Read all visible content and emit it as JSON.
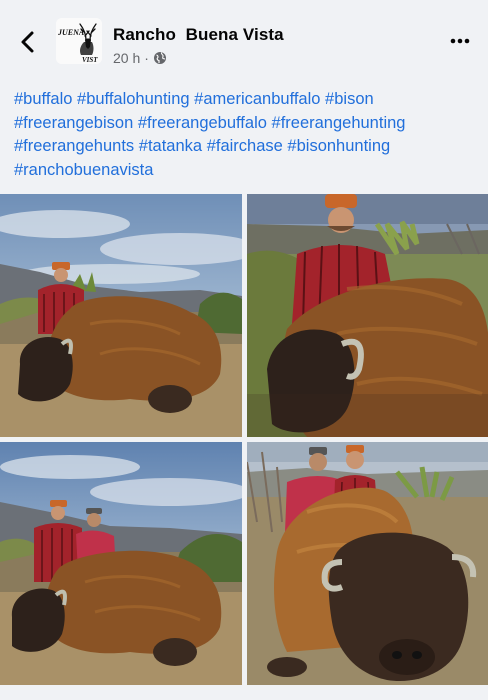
{
  "post": {
    "page_name": "Rancho  Buena Vista",
    "timestamp": "20 h",
    "separator": "·",
    "privacy_icon": "globe-icon",
    "logo_text_top": "JUENA",
    "logo_text_bottom": "VIST"
  },
  "header": {
    "back_icon": "chevron-left-icon",
    "more_icon": "more-dots-icon"
  },
  "caption": {
    "hashtags": [
      "#buffalo",
      "#buffalohunting",
      "#americanbuffalo",
      "#bison",
      "#freerangebison",
      "#freerangebuffalo",
      "#freerangehunting",
      "#freerangehunts",
      "#tatanka",
      "#fairchase",
      "#bisonhunting",
      "#ranchobuenavista"
    ]
  },
  "photos": [
    {
      "name": "photo-hunter-with-bison-1"
    },
    {
      "name": "photo-hunter-with-bison-closeup"
    },
    {
      "name": "photo-two-hunters-with-bison"
    },
    {
      "name": "photo-two-hunters-behind-bison"
    }
  ],
  "colors": {
    "link": "#216fdb",
    "background": "#f0f2f5",
    "meta": "#65676b"
  }
}
